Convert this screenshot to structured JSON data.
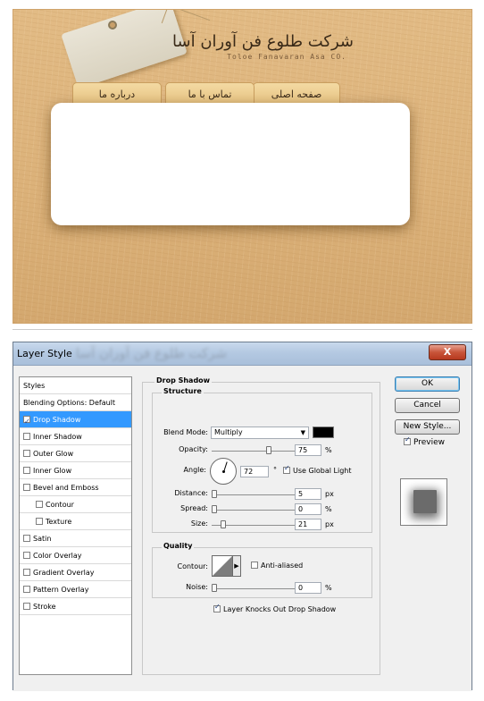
{
  "site": {
    "title": "شرکت طلوع فن آوران آسا",
    "subtitle": "Toloe Fanavaran Asa CO.",
    "tabs": [
      "صفحه اصلی",
      "تماس با ما",
      "درباره ما"
    ]
  },
  "dialog": {
    "title": "Layer Style",
    "close_label": "X",
    "title_ghost": "شرکت طلوع فن آوران آسا"
  },
  "styles_list": {
    "header": "Styles",
    "items": [
      {
        "label": "Blending Options: Default",
        "has_checkbox": false,
        "checked": false,
        "selected": false,
        "indent": false
      },
      {
        "label": "Drop Shadow",
        "has_checkbox": true,
        "checked": true,
        "selected": true,
        "indent": false
      },
      {
        "label": "Inner Shadow",
        "has_checkbox": true,
        "checked": false,
        "selected": false,
        "indent": false
      },
      {
        "label": "Outer Glow",
        "has_checkbox": true,
        "checked": false,
        "selected": false,
        "indent": false
      },
      {
        "label": "Inner Glow",
        "has_checkbox": true,
        "checked": false,
        "selected": false,
        "indent": false
      },
      {
        "label": "Bevel and Emboss",
        "has_checkbox": true,
        "checked": false,
        "selected": false,
        "indent": false
      },
      {
        "label": "Contour",
        "has_checkbox": true,
        "checked": false,
        "selected": false,
        "indent": true
      },
      {
        "label": "Texture",
        "has_checkbox": true,
        "checked": false,
        "selected": false,
        "indent": true
      },
      {
        "label": "Satin",
        "has_checkbox": true,
        "checked": false,
        "selected": false,
        "indent": false
      },
      {
        "label": "Color Overlay",
        "has_checkbox": true,
        "checked": false,
        "selected": false,
        "indent": false
      },
      {
        "label": "Gradient Overlay",
        "has_checkbox": true,
        "checked": false,
        "selected": false,
        "indent": false
      },
      {
        "label": "Pattern Overlay",
        "has_checkbox": true,
        "checked": false,
        "selected": false,
        "indent": false
      },
      {
        "label": "Stroke",
        "has_checkbox": true,
        "checked": false,
        "selected": false,
        "indent": false
      }
    ]
  },
  "drop_shadow": {
    "section_title": "Drop Shadow",
    "structure_title": "Structure",
    "blend_mode_label": "Blend Mode:",
    "blend_mode_value": "Multiply",
    "shadow_color": "#000000",
    "opacity_label": "Opacity:",
    "opacity_value": "75",
    "angle_label": "Angle:",
    "angle_value": "72",
    "angle_unit": "°",
    "use_global_light_label": "Use Global Light",
    "use_global_light_checked": true,
    "distance_label": "Distance:",
    "distance_value": "5",
    "spread_label": "Spread:",
    "spread_value": "0",
    "size_label": "Size:",
    "size_value": "21",
    "unit_px": "px",
    "unit_percent": "%",
    "quality_title": "Quality",
    "contour_label": "Contour:",
    "anti_aliased_label": "Anti-aliased",
    "anti_aliased_checked": false,
    "noise_label": "Noise:",
    "noise_value": "0",
    "knocks_out_label": "Layer Knocks Out Drop Shadow",
    "knocks_out_checked": true
  },
  "buttons": {
    "ok": "OK",
    "cancel": "Cancel",
    "new_style": "New Style...",
    "preview_label": "Preview",
    "preview_checked": true
  }
}
